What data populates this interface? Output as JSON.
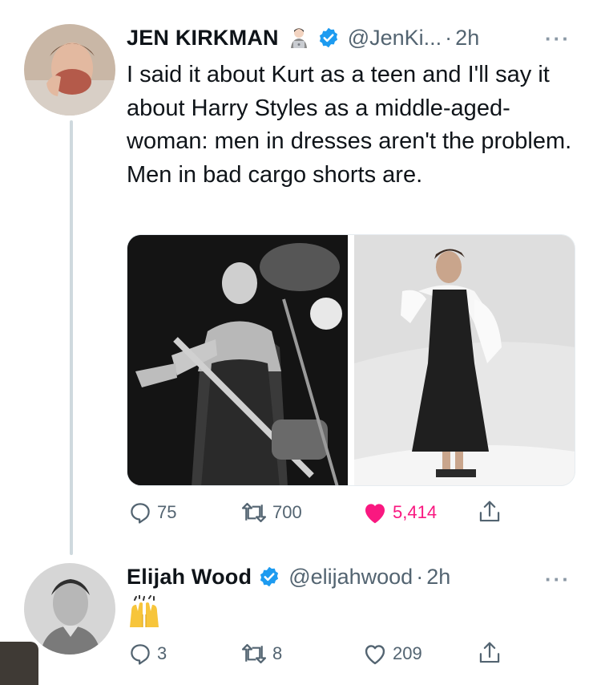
{
  "tweets": [
    {
      "name": "JEN KIRKMAN",
      "handle": "@JenKi...",
      "separator": "·",
      "time": "2h",
      "text": "I said it about Kurt as a teen and I'll say it about Harry Styles as a middle-aged-woman: men in dresses aren't the problem. Men in bad cargo shorts are.",
      "actions": {
        "replies": "75",
        "retweets": "700",
        "likes": "5,414"
      },
      "liked": true
    },
    {
      "name": "Elijah Wood",
      "handle": "@elijahwood",
      "separator": "·",
      "time": "2h",
      "text_emoji": "raising-hands-emoji",
      "actions": {
        "replies": "3",
        "retweets": "8",
        "likes": "209"
      },
      "liked": false
    }
  ],
  "colors": {
    "verified": "#1d9bf0",
    "like": "#f91880",
    "muted": "#536471",
    "thread_line": "#cfd9de"
  },
  "icons": [
    "reply-icon",
    "retweet-icon",
    "like-icon",
    "share-icon",
    "verified-badge-icon",
    "more-icon"
  ]
}
